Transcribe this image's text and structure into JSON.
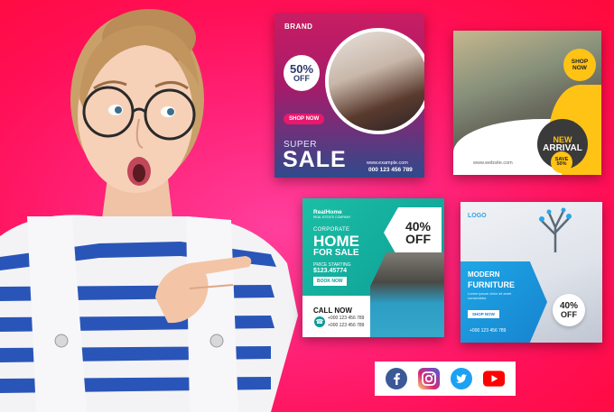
{
  "colors": {
    "background": "#ff1f6e",
    "card1_blue": "#2f4a8c",
    "card1_pink": "#e8186e",
    "card2_yellow": "#ffc316",
    "card3_teal": "#0d9c96",
    "card4_blue": "#1683cf"
  },
  "card1": {
    "brand": "BRAND",
    "discount_pct": "50%",
    "discount_off": "OFF",
    "shop": "SHOP NOW",
    "super": "SUPER",
    "sale": "SALE",
    "phone_prefix": "www.example.com",
    "phone": "000 123 456 789"
  },
  "card2": {
    "shop_line1": "SHOP",
    "shop_line2": "NOW",
    "new": "NEW",
    "arrival": "ARRIVAL",
    "save_word": "SAVE",
    "save_pct": "50%",
    "website": "www.website.com"
  },
  "card3": {
    "logo": "RealHome",
    "logo_sub": "REAL ESTATE COMPANY",
    "corporate": "CORPORATE",
    "home": "HOME",
    "for_sale": "FOR SALE",
    "price_label": "PRICE STARTING",
    "price": "$123.45774",
    "book": "BOOK NOW",
    "pct": "40%",
    "off": "OFF",
    "call": "CALL NOW",
    "phone1": "+000 123 456 789",
    "phone2": "+000 123 456 789",
    "phone_icon": "phone-icon"
  },
  "card4": {
    "logo": "LOGO",
    "modern": "MODERN",
    "furniture": "FURNITURE",
    "subtitle": "Lorem ipsum dolor sit amet consectetur",
    "shop": "SHOP NOW",
    "phone": "+000 123 456 789",
    "pct": "40%",
    "off": "OFF"
  },
  "social": {
    "icons": [
      "facebook-icon",
      "instagram-icon",
      "twitter-icon",
      "youtube-icon"
    ]
  }
}
